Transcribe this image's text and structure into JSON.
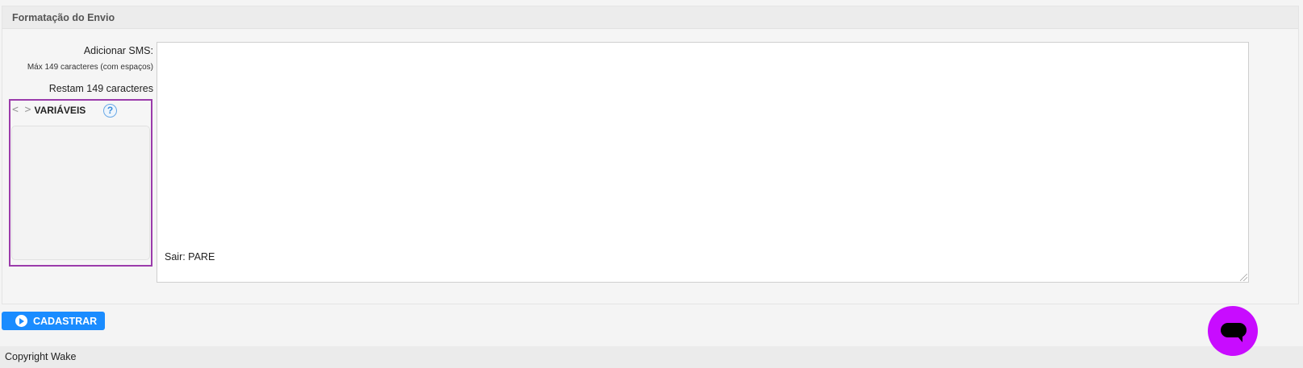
{
  "panel": {
    "title": "Formatação do Envio"
  },
  "sms_form": {
    "add_label": "Adicionar SMS:",
    "max_hint": "Máx 149 caracteres (com espaços)",
    "remaining": "Restam 149 caracteres",
    "message_footer": "Sair: PARE",
    "message_value": ""
  },
  "variables": {
    "code_symbol": "< >",
    "title": "VARIÁVEIS",
    "help_symbol": "?",
    "items": []
  },
  "actions": {
    "submit_label": "CADASTRAR"
  },
  "footer": {
    "copyright": "Copyright Wake"
  },
  "colors": {
    "primary_button": "#1a8cff",
    "variables_border": "#9b3cab",
    "chat_fab": "#c80cff"
  },
  "icons": {
    "submit": "play-circle-icon",
    "help": "question-circle-icon",
    "chat": "chat-bubble-icon"
  }
}
